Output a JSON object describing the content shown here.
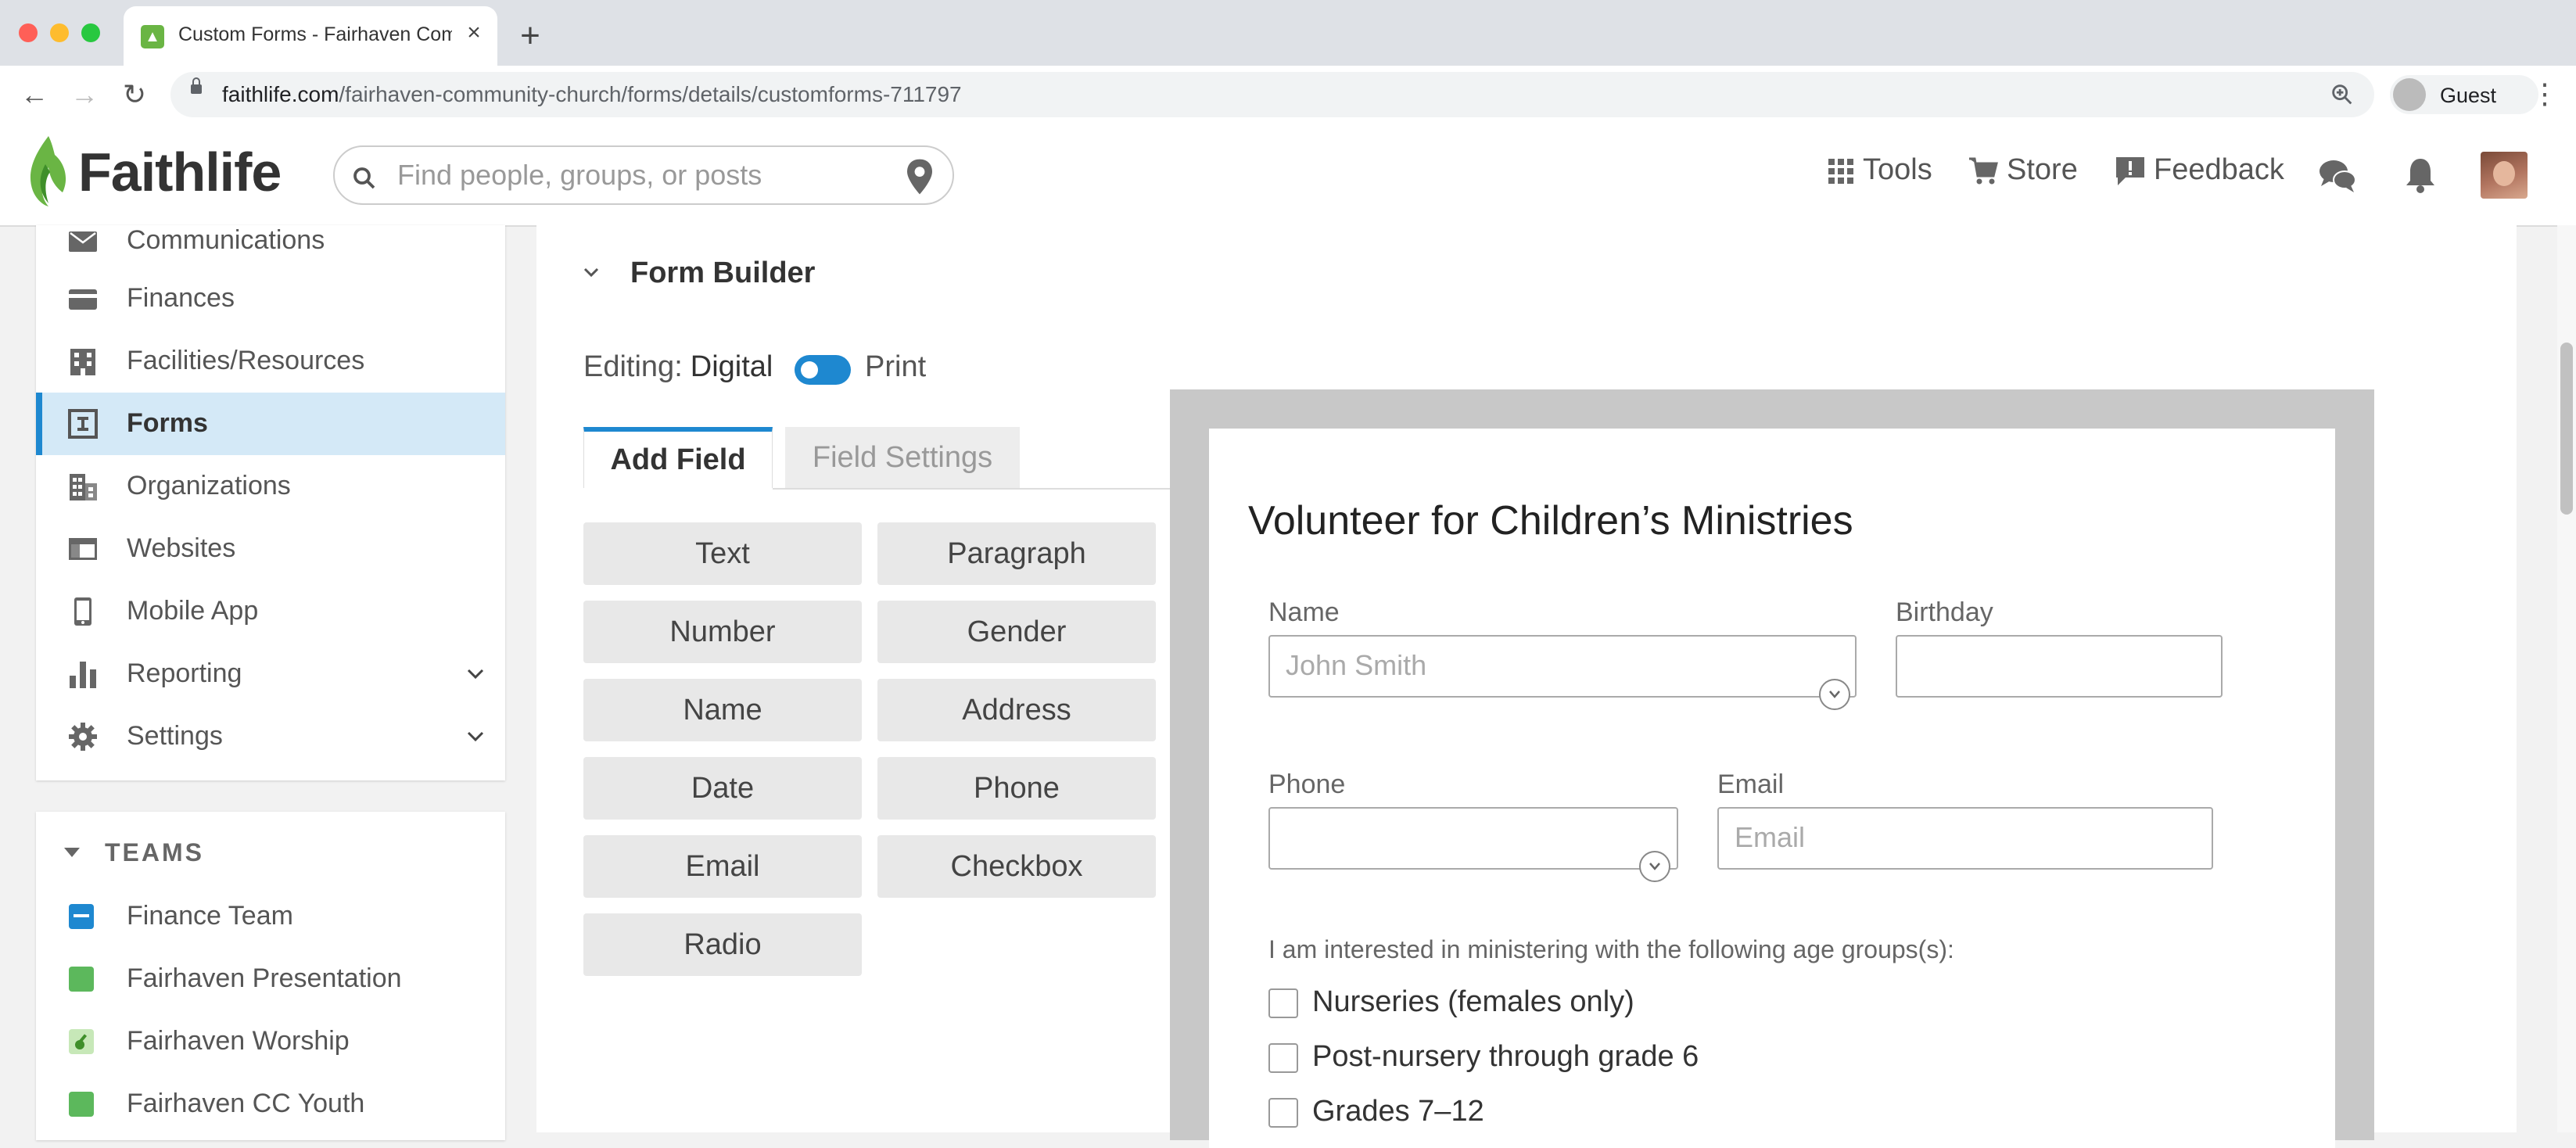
{
  "browser": {
    "tab_title": "Custom Forms - Fairhaven Community Church",
    "new_tab": "+",
    "url_domain": "faithlife.com",
    "url_path": "/fairhaven-community-church/forms/details/customforms-711797",
    "profile_name": "Guest"
  },
  "header": {
    "logo": "Faithlife",
    "search_placeholder": "Find people, groups, or posts",
    "nav": {
      "tools": "Tools",
      "store": "Store",
      "feedback": "Feedback"
    }
  },
  "sidebar": {
    "items": [
      {
        "label": "Communications",
        "icon": "envelope-icon"
      },
      {
        "label": "Finances",
        "icon": "credit-card-icon"
      },
      {
        "label": "Facilities/Resources",
        "icon": "building-icon"
      },
      {
        "label": "Forms",
        "icon": "form-icon",
        "active": true
      },
      {
        "label": "Organizations",
        "icon": "organizations-icon"
      },
      {
        "label": "Websites",
        "icon": "website-icon"
      },
      {
        "label": "Mobile App",
        "icon": "mobile-icon"
      },
      {
        "label": "Reporting",
        "icon": "bar-chart-icon"
      },
      {
        "label": "Settings",
        "icon": "gear-icon"
      }
    ],
    "teams_header": "TEAMS",
    "teams": [
      {
        "label": "Finance Team",
        "color": "#1e88d0"
      },
      {
        "label": "Fairhaven Presentation",
        "color": "#5cb85c"
      },
      {
        "label": "Fairhaven Worship",
        "color": "#5cb85c"
      },
      {
        "label": "Fairhaven CC Youth",
        "color": "#5cb85c"
      }
    ]
  },
  "main": {
    "section_title": "Form Builder",
    "editing_label": "Editing:",
    "digital_label": "Digital",
    "print_label": "Print",
    "tabs": {
      "add_field": "Add Field",
      "field_settings": "Field Settings"
    },
    "field_buttons": [
      "Text",
      "Paragraph",
      "Number",
      "Gender",
      "Name",
      "Address",
      "Date",
      "Phone",
      "Email",
      "Checkbox",
      "Radio"
    ]
  },
  "form": {
    "title": "Volunteer for Children’s Ministries",
    "name_label": "Name",
    "name_placeholder": "John Smith",
    "birthday_label": "Birthday",
    "phone_label": "Phone",
    "email_label": "Email",
    "email_placeholder": "Email",
    "interest_text": "I am interested in ministering with the following age groups(s):",
    "options": [
      "Nurseries (females only)",
      "Post-nursery through grade 6",
      "Grades 7–12"
    ]
  },
  "colors": {
    "accent": "#1e88d0",
    "brand_green": "#6ab544",
    "active_bg": "#d4e9f7"
  }
}
